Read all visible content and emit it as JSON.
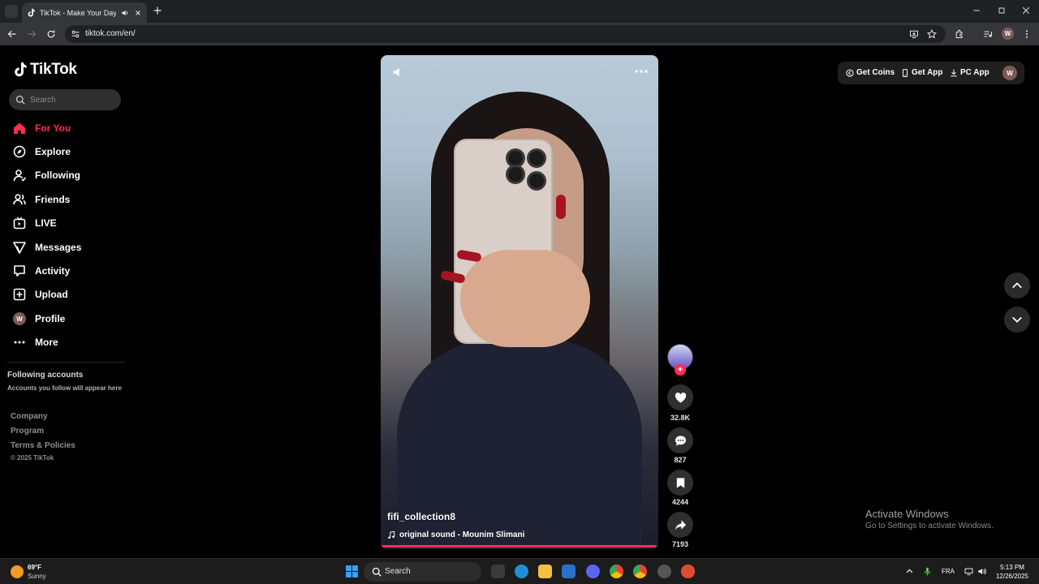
{
  "browser": {
    "tab_title": "TikTok - Make Your Day",
    "url": "tiktok.com/en/",
    "profile_initial": "W"
  },
  "sidebar": {
    "logo_text": "TikTok",
    "search_placeholder": "Search",
    "nav": [
      {
        "label": "For You",
        "icon": "home-icon",
        "active": true
      },
      {
        "label": "Explore",
        "icon": "compass-icon"
      },
      {
        "label": "Following",
        "icon": "following-icon"
      },
      {
        "label": "Friends",
        "icon": "friends-icon"
      },
      {
        "label": "LIVE",
        "icon": "live-icon"
      },
      {
        "label": "Messages",
        "icon": "messages-icon"
      },
      {
        "label": "Activity",
        "icon": "activity-icon"
      },
      {
        "label": "Upload",
        "icon": "upload-icon"
      },
      {
        "label": "Profile",
        "icon": "avatar",
        "initial": "W"
      },
      {
        "label": "More",
        "icon": "more-icon"
      }
    ],
    "following_title": "Following accounts",
    "following_sub": "Accounts you follow will appear here",
    "footer": [
      "Company",
      "Program",
      "Terms & Policies"
    ],
    "copyright": "© 2025 TikTok"
  },
  "video": {
    "username": "fifi_collection8",
    "sound": "original sound - Mounim Slimani",
    "progress": 0.99
  },
  "actions": {
    "likes": "32.8K",
    "comments": "827",
    "saves": "4244",
    "shares": "7193",
    "follow_symbol": "+"
  },
  "top_actions": {
    "coins": "Get Coins",
    "app": "Get App",
    "pc_app": "PC App",
    "avatar_initial": "W"
  },
  "watermark": {
    "line1": "Activate Windows",
    "line2": "Go to Settings to activate Windows."
  },
  "taskbar": {
    "temp": "69°F",
    "condition": "Sunny",
    "search": "Search",
    "lang": "FRA",
    "time": "5:13 PM",
    "date": "12/26/2025"
  },
  "colors": {
    "accent": "#fe2c55",
    "background": "#000000",
    "chrome": "#35363a"
  }
}
